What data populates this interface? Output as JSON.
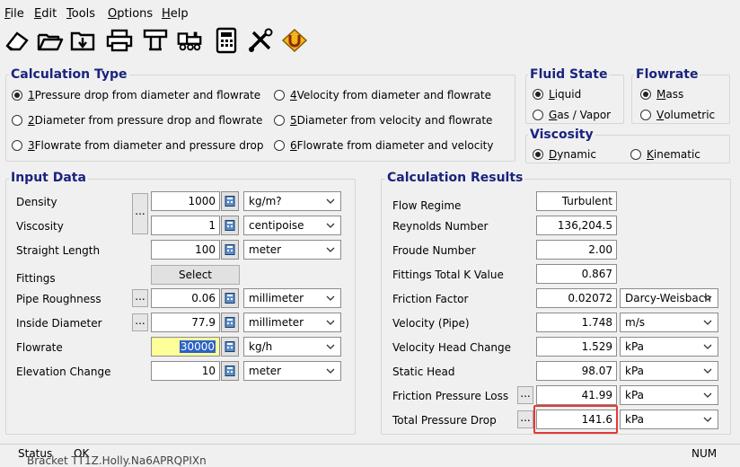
{
  "menu": {
    "file": {
      "accel": "F",
      "rest": "ile"
    },
    "edit": {
      "accel": "E",
      "rest": "dit"
    },
    "tools": {
      "accel": "T",
      "rest": "ools"
    },
    "options": {
      "accel": "O",
      "rest": "ptions"
    },
    "help": {
      "accel": "H",
      "rest": "elp"
    }
  },
  "calc_type": {
    "title": "Calculation Type",
    "options": [
      {
        "num": "1",
        "text": " Pressure drop from diameter and flowrate",
        "selected": true
      },
      {
        "num": "2",
        "text": " Diameter from pressure drop and flowrate",
        "selected": false
      },
      {
        "num": "3",
        "text": " Flowrate from diameter and pressure drop",
        "selected": false
      },
      {
        "num": "4",
        "text": " Velocity from diameter and flowrate",
        "selected": false
      },
      {
        "num": "5",
        "text": " Diameter from velocity and flowrate",
        "selected": false
      },
      {
        "num": "6",
        "text": " Flowrate from diameter and velocity",
        "selected": false
      }
    ]
  },
  "fluid_state": {
    "title": "Fluid State",
    "liquid": {
      "accel": "L",
      "rest": "iquid"
    },
    "gas": {
      "accel": "G",
      "rest": "as / Vapor"
    }
  },
  "flowrate_type": {
    "title": "Flowrate",
    "mass": {
      "accel": "M",
      "rest": "ass"
    },
    "volumetric": {
      "accel": "V",
      "rest": "olumetric"
    }
  },
  "viscosity_type": {
    "title": "Viscosity",
    "dynamic": {
      "accel": "D",
      "rest": "ynamic"
    },
    "kinematic": {
      "accel": "K",
      "rest": "inematic"
    }
  },
  "input": {
    "title": "Input Data",
    "density": {
      "label": "Density",
      "value": "1000",
      "unit": "kg/m?"
    },
    "viscosity": {
      "label": "Viscosity",
      "value": "1",
      "unit": "centipoise"
    },
    "length": {
      "label": "Straight Length",
      "value": "100",
      "unit": "meter"
    },
    "fittings": {
      "label": "Fittings",
      "button": "Select"
    },
    "roughness": {
      "label": "Pipe Roughness",
      "value": "0.06",
      "unit": "millimeter"
    },
    "diameter": {
      "label": "Inside Diameter",
      "value": "77.9",
      "unit": "millimeter"
    },
    "flowrate": {
      "label": "Flowrate",
      "value": "30000",
      "unit": "kg/h"
    },
    "elevation": {
      "label": "Elevation Change",
      "value": "10",
      "unit": "meter"
    },
    "dots": "..."
  },
  "results": {
    "title": "Calculation Results",
    "flow_regime": {
      "label": "Flow Regime",
      "value": "Turbulent"
    },
    "reynolds": {
      "label": "Reynolds Number",
      "value": "136,204.5"
    },
    "froude": {
      "label": "Froude Number",
      "value": "2.00"
    },
    "fittings_k": {
      "label": "Fittings Total K Value",
      "value": "0.867"
    },
    "friction_factor": {
      "label": "Friction Factor",
      "value": "0.02072",
      "unit": "Darcy-Weisbach"
    },
    "velocity": {
      "label": "Velocity (Pipe)",
      "value": "1.748",
      "unit": "m/s"
    },
    "velocity_head": {
      "label": "Velocity Head Change",
      "value": "1.529",
      "unit": "kPa"
    },
    "static_head": {
      "label": "Static Head",
      "value": "98.07",
      "unit": "kPa"
    },
    "friction_loss": {
      "label": "Friction Pressure Loss",
      "value": "41.99",
      "unit": "kPa"
    },
    "total_drop": {
      "label": "Total Pressure Drop",
      "value": "141.6",
      "unit": "kPa"
    }
  },
  "status": {
    "label": "Status",
    "value": "OK",
    "num": "NUM"
  },
  "overlay": "Bracket TT1Z.Holly.Na6APRQPIXn"
}
